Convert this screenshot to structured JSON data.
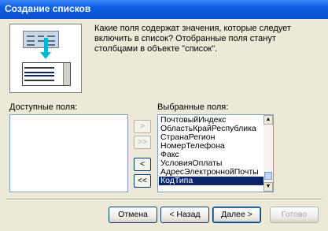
{
  "window": {
    "title": "Создание списков"
  },
  "instructions": "Какие поля содержат значения, которые следует включить в список? Отобранные поля станут столбцами в объекте \"список\".",
  "available": {
    "label": "Доступные поля:",
    "items": []
  },
  "selected": {
    "label": "Выбранные поля:",
    "items": [
      "ПочтовыйИндекс",
      "ОбластьКрайРеспублика",
      "СтранаРегион",
      "НомерТелефона",
      "Факс",
      "УсловияОплаты",
      "АдресЭлектроннойПочты",
      "КодТипа"
    ],
    "selected_item": "КодТипа"
  },
  "move_buttons": {
    "add": ">",
    "add_all": ">>",
    "remove": "<",
    "remove_all": "<<"
  },
  "scroll": {
    "up": "▲",
    "down": "▼"
  },
  "buttons": {
    "cancel": "Отмена",
    "back": "< Назад",
    "next": "Далее >",
    "finish": "Готово"
  }
}
